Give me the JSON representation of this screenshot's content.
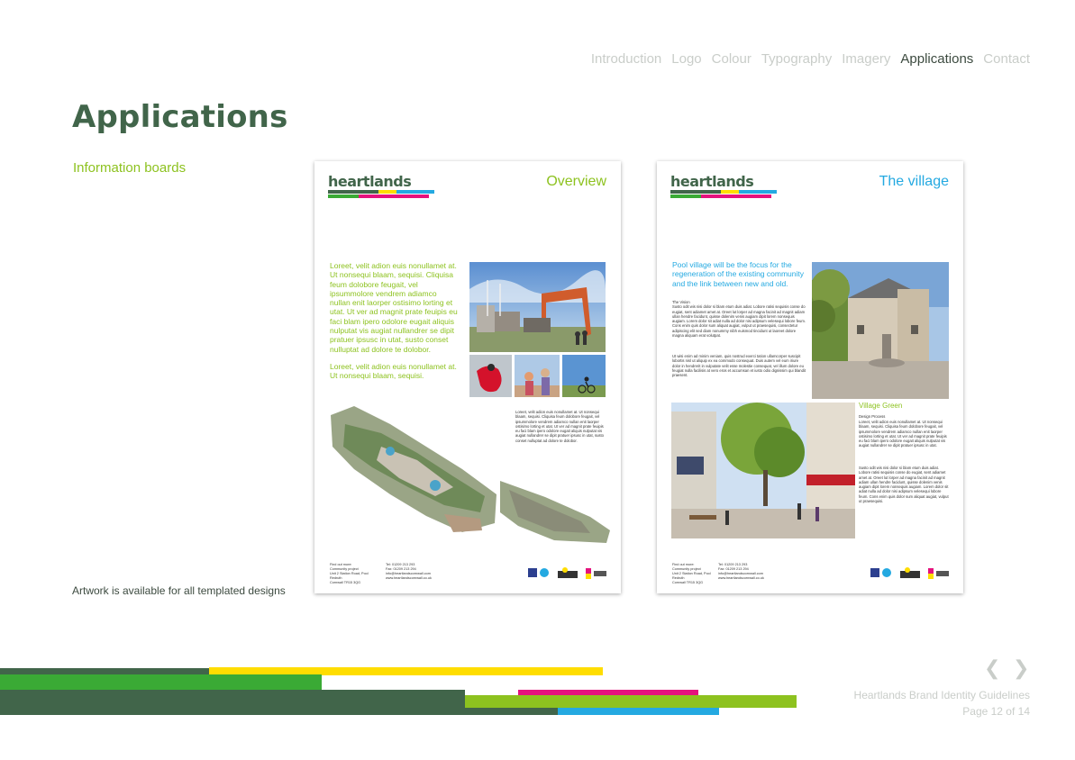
{
  "nav": {
    "items": [
      "Introduction",
      "Logo",
      "Colour",
      "Typography",
      "Imagery",
      "Applications",
      "Contact"
    ],
    "active": "Applications"
  },
  "page": {
    "title": "Applications",
    "section": "Information boards",
    "note": "Artwork is available for all templated designs"
  },
  "boards": [
    {
      "brand": "heartlands",
      "heading": "Overview",
      "intro": "Loreet, velit adion euis nonullamet at. Ut nonsequi blaam, sequisi. Cliquisa feum dolobore feugait, vel ipsummolore vendrem adiamco nullan enit laorper ostisimo lorting et utat. Ut ver ad magnit prate feuipis eu faci blam ipero odolore eugait aliquis nulputat vis augiat nullandrer se dipit pratuer ipsusc in utat, susto conset nulluptat ad dolore te dolobor.",
      "intro2": "Loreet, velit adion euis nonullamet at. Ut nonsequi blaam, sequisi.",
      "body": "Loreet, velit adion euis nonullamet at. Ut nonsequi blaam, sequisi. Cliquisa feum dolobore feugait, vel ipsummolore vendrem adiamco nullan enit laorper ostisimo lorting et utat. Ut ver ad magnit prate feuipis eu faci blam ipero odolore eugait aliquis nulputat vis augiat nullandrer se dipit pratuer ipsusc in utat, susto conset nulluptat ad dolore te dolobor.",
      "contact_left": "Find out more:\nCommunity project\nUnit 2 Station Road, Pool Redruth\nCornwall TR15 3QG",
      "contact_right": "Tel: 01209 213 293\nFax: 01209 213 294\ninfo@heartlandscornwall.com\nwww.heartlandscornwall.co.uk"
    },
    {
      "brand": "heartlands",
      "heading": "The village",
      "intro": "Pool village will be the focus for the regeneration of the existing community and the link between new and old.",
      "body": "The Vision\nSusto odit wis nisi dolor si blam etum duis adiat. Lobore ratisi sequisis conse do eugiat, sent adiamet amet at. Oreet lut lorper ad magna facinit ad magnit adiam ullan hendre facidunt, quisse dolenim venis augiam dipit lorem nonsequis augiam. Lorem dolor sit adiat nulla ad dolor nisi adipsum velesequi lobore feum. Cons enim quis dolor sum aliquat augiat, vulput ut praesequisi, consectetur adipiscing elit sed diam nonummy nibh euismod tincidunt ut laoreet dolore magna aliquam erat volutpat.",
      "body2": "Ut wisi enim ad minim veniam, quis nostrud exerci tation ullamcorper suscipit lobortis nisl ut aliquip ex ea commodo consequat. Duis autem vel eum iriure dolor in hendrerit in vulputate velit esse molestie consequat, vel illum dolore eu feugiat nulla facilisis at vero eros et accumsan et iusto odio dignissim qui blandit praesent.",
      "sub_heading": "Village Green",
      "sub_label": "Design Process",
      "sub_body": "Loreet, velit adion euis nonullamet at. Ut nonsequi blaam, sequisi. Cliquisa feum dolobore feugait, vel ipsummolore vendrem adiamco nullan enit laorper ostisimo lorting et utat. Ut ver ad magnit prate feuipis eu faci blam ipero odolore eugait aliquis nulputat vis augiat nullandrer se dipit pratuer ipsusc in utat.",
      "sub_body2": "Susto odit wis nisi dolor si blam etum duis adiat. Lobore ratisi sequisis conse do eugiat, sent adiamet amet at. Oreet lut lorper ad magna facinit ad magnit adiam ullan hendre facidunt, quisse dolenim venis augiam dipit lorem nonsequis augiam. Lorem dolor sit adiat nulla ad dolor nisi adipsum velesequi lobore feum. Cons enim quis dolor sum aliquat augiat, vulput ut praesequisi.",
      "contact_left": "Find out more:\nCommunity project\nUnit 2 Station Road, Pool Redruth\nCornwall TR15 3QG",
      "contact_right": "Tel: 01209 213 293\nFax: 01209 213 294\ninfo@heartlandscornwall.com\nwww.heartlandscornwall.co.uk"
    }
  ],
  "footer": {
    "title": "Heartlands Brand Identity Guidelines",
    "page": "Page 12 of 14",
    "prev_icon": "chevron-left-icon",
    "next_icon": "chevron-right-icon"
  },
  "colors": {
    "dark_green": "#41654a",
    "lime": "#8dc21f",
    "green": "#3aaa35",
    "yellow": "#ffdd00",
    "magenta": "#e5127d",
    "blue": "#24a9e1",
    "grey_text": "#c9cdc9"
  }
}
